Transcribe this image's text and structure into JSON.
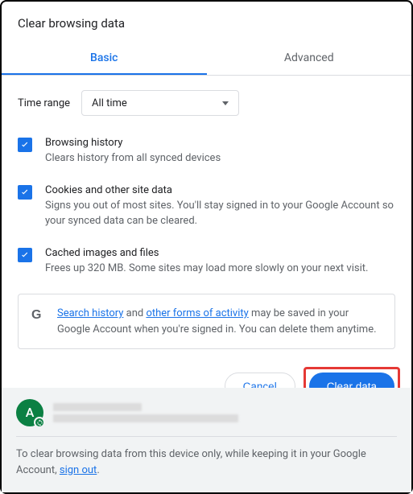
{
  "dialog": {
    "title": "Clear browsing data"
  },
  "tabs": {
    "basic": "Basic",
    "advanced": "Advanced"
  },
  "time": {
    "label": "Time range",
    "value": "All time"
  },
  "options": {
    "history": {
      "title": "Browsing history",
      "desc": "Clears history from all synced devices"
    },
    "cookies": {
      "title": "Cookies and other site data",
      "desc": "Signs you out of most sites. You'll stay signed in to your Google Account so your synced data can be cleared."
    },
    "cache": {
      "title": "Cached images and files",
      "desc": "Frees up 320 MB. Some sites may load more slowly on your next visit."
    }
  },
  "info": {
    "link1": "Search history",
    "mid1": " and ",
    "link2": "other forms of activity",
    "rest": " may be saved in your Google Account when you're signed in. You can delete them anytime."
  },
  "buttons": {
    "cancel": "Cancel",
    "clear": "Clear data"
  },
  "account": {
    "initial": "A"
  },
  "footer": {
    "text": "To clear browsing data from this device only, while keeping it in your Google Account, ",
    "link": "sign out",
    "tail": "."
  }
}
